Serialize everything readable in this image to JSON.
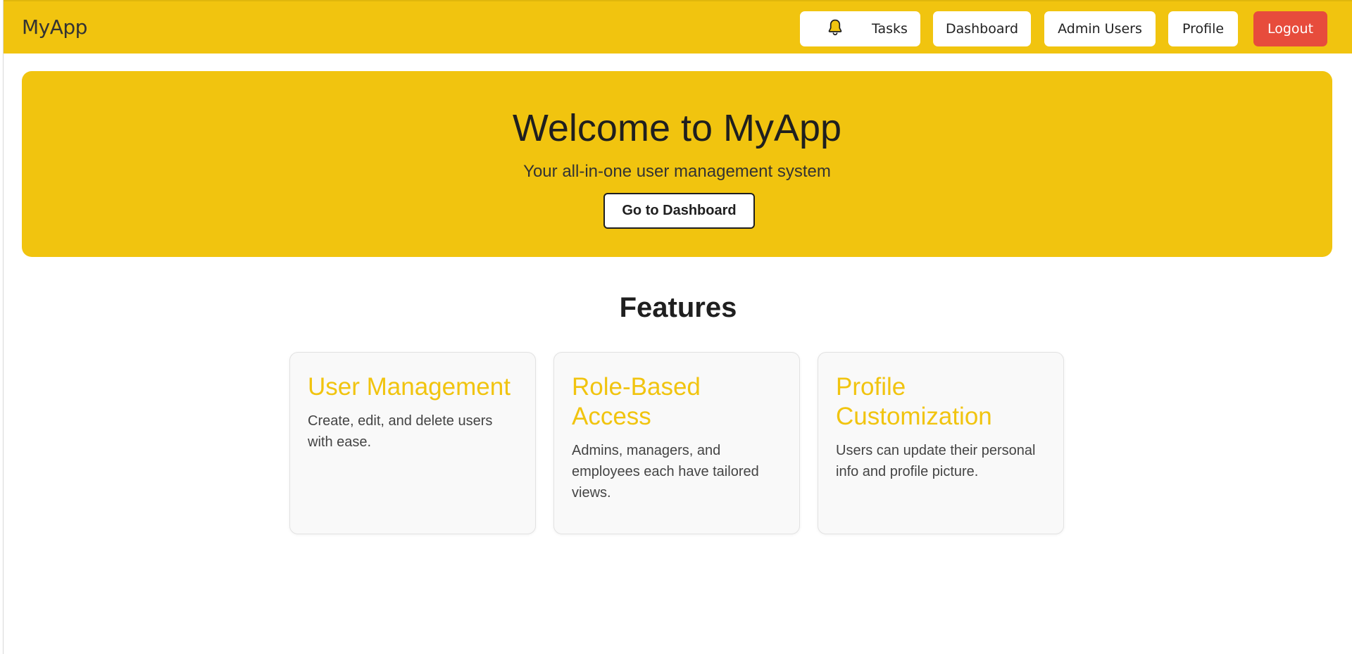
{
  "navbar": {
    "brand": "MyApp",
    "notifications_icon": "bell-icon",
    "items": [
      "Tasks",
      "Dashboard",
      "Admin Users",
      "Profile"
    ],
    "logout_label": "Logout",
    "accent_color": "#f1c40f",
    "logout_color": "#e74c3c"
  },
  "hero": {
    "title": "Welcome to MyApp",
    "subtitle": "Your all-in-one user management system",
    "cta_label": "Go to Dashboard"
  },
  "features": {
    "heading": "Features",
    "cards": [
      {
        "title": "User Management",
        "description": "Create, edit, and delete users with ease."
      },
      {
        "title": "Role-Based Access",
        "description": "Admins, managers, and employees each have tailored views."
      },
      {
        "title": "Profile Customization",
        "description": "Users can update their personal info and profile picture."
      }
    ]
  }
}
